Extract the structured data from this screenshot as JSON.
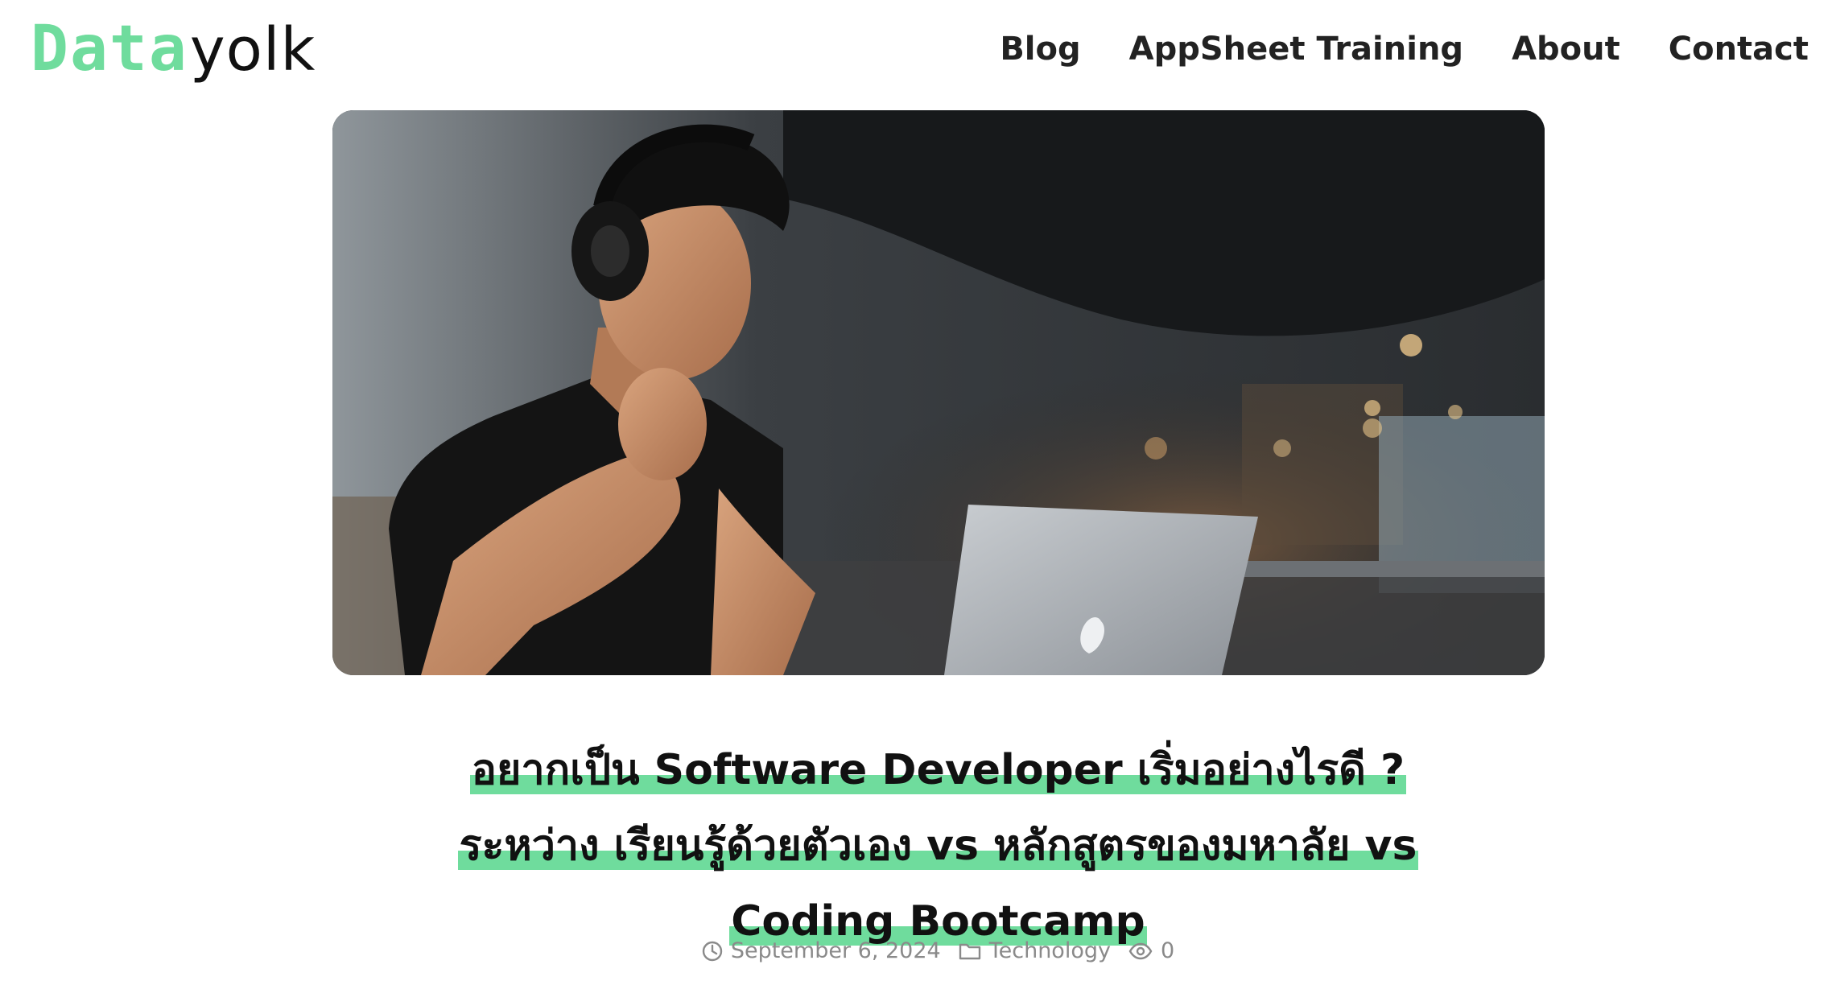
{
  "site": {
    "logo_part1": "Data",
    "logo_part2": "yolk",
    "brand_color": "#6fdc9d"
  },
  "nav": {
    "items": [
      {
        "label": "Blog"
      },
      {
        "label": "AppSheet Training"
      },
      {
        "label": "About"
      },
      {
        "label": "Contact"
      }
    ]
  },
  "hero": {
    "image_alt": ""
  },
  "post": {
    "title_line1": "อยากเป็น Software Developer เริ่มอย่างไรดี ?",
    "title_line2": "ระหว่าง เรียนรู้ด้วยตัวเอง vs หลักสูตรของมหาลัย vs",
    "title_line3": "Coding Bootcamp",
    "date": "September 6, 2024",
    "category": "Technology",
    "views": "0",
    "icons": [
      "clock-icon",
      "folder-icon",
      "eye-icon"
    ]
  }
}
